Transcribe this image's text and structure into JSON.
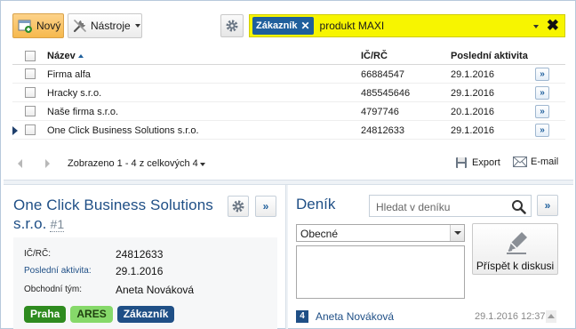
{
  "toolbar": {
    "new_label": "Nový",
    "tools_label": "Nástroje",
    "new_icon": "new-record-icon",
    "tools_icon": "tools-icon",
    "settings_icon": "gear-icon"
  },
  "filter": {
    "chip_label": "Zákazník",
    "text": "produkt MAXI",
    "background": "#f7f500"
  },
  "grid": {
    "columns": [
      "Název",
      "IČ/RČ",
      "Poslední aktivita"
    ],
    "rows": [
      {
        "name": "Firma alfa",
        "ic": "66884547",
        "activity": "29.1.2016",
        "open": "»"
      },
      {
        "name": "Hracky s.r.o.",
        "ic": "485545646",
        "activity": "29.1.2016",
        "open": "»"
      },
      {
        "name": "Naše firma s.r.o.",
        "ic": "4797746",
        "activity": "20.1.2016",
        "open": "»"
      },
      {
        "name": "One Click Business Solutions s.r.o.",
        "ic": "24812633",
        "activity": "29.1.2016",
        "open": "»"
      }
    ],
    "selected_row": 4
  },
  "pager": {
    "text": "Zobrazeno 1 - 4 z celkových 4",
    "export_label": "Export",
    "email_label": "E-mail"
  },
  "detail": {
    "title": "One Click Business Solutions s.r.o.",
    "number": "#1",
    "expand_label": "»",
    "fields": [
      {
        "label": "IČ/RČ:",
        "value": "24812633"
      },
      {
        "label": "Poslední aktivita:",
        "value": "29.1.2016"
      },
      {
        "label": "Obchodní tým:",
        "value": "Aneta Nováková"
      }
    ],
    "tags": [
      {
        "label": "Praha",
        "bg": "#2e8b1f",
        "fg": "#ffffff"
      },
      {
        "label": "ARES",
        "bg": "#86d96a",
        "fg": "#1f3f10"
      },
      {
        "label": "Zákazník",
        "bg": "#1f4f86",
        "fg": "#ffffff"
      }
    ]
  },
  "journal": {
    "title": "Deník",
    "search_placeholder": "Hledat v deníku",
    "expand_label": "»",
    "category": "Obecné",
    "post_label": "Příspět k diskusi",
    "entry": {
      "count": "4",
      "author": "Aneta Nováková",
      "time": "29.1.2016 12:37"
    }
  },
  "colors": {
    "accent": "#1f4f86",
    "new_button": "#f6b94d"
  }
}
